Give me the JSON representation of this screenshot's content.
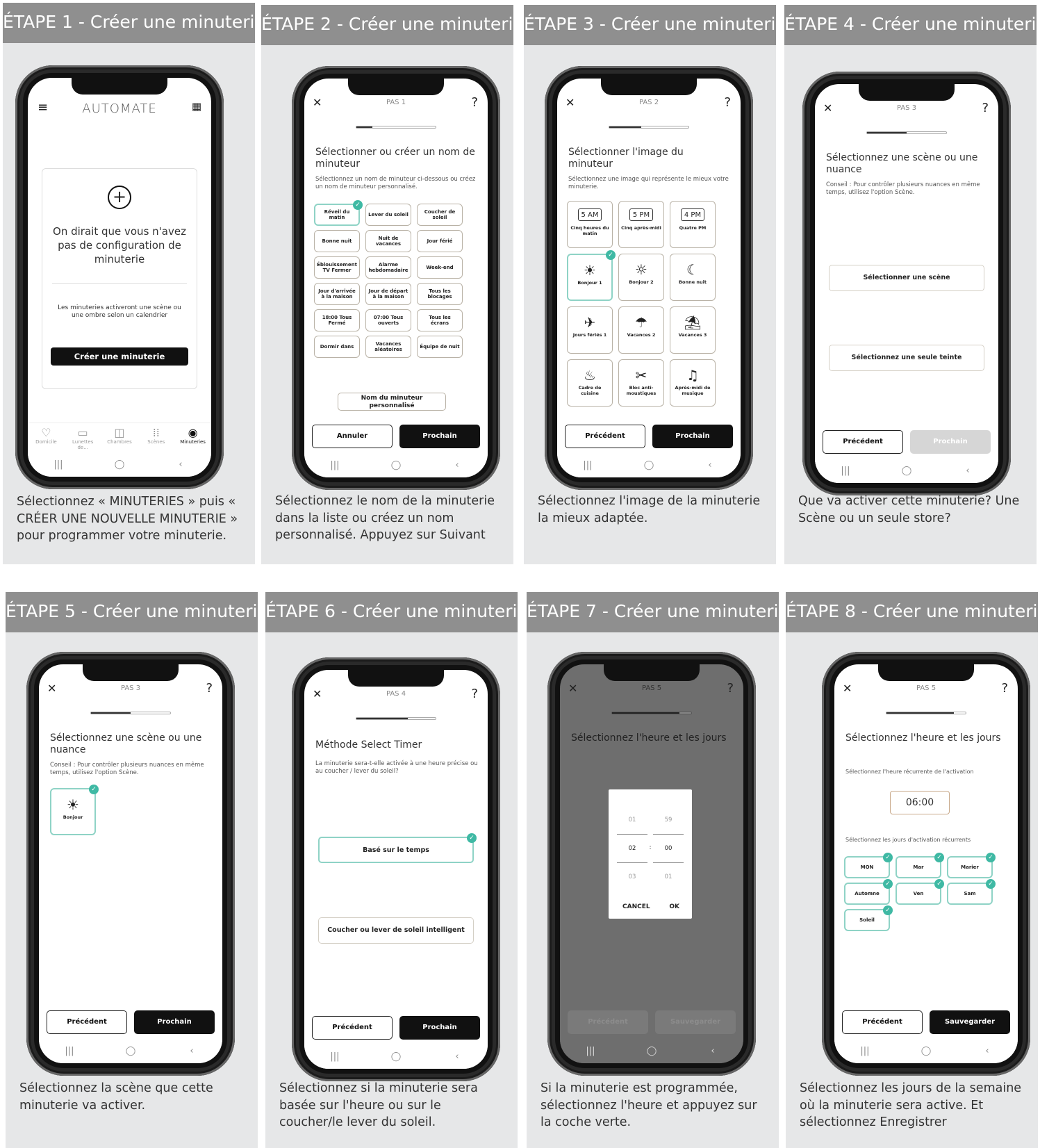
{
  "steps": [
    {
      "header": "ÉTAPE 1 - Créer une minuterie",
      "caption": "Sélectionnez « MINUTERIES » puis « CRÉER UNE NOUVELLE MINUTERIE » pour programmer votre minuterie."
    },
    {
      "header": "ÉTAPE 2 - Créer une minuterie",
      "caption": "Sélectionnez le nom de la minuterie dans la liste ou créez un nom personnalisé. Appuyez sur Suivant"
    },
    {
      "header": "ÉTAPE 3 - Créer une minuterie",
      "caption": "Sélectionnez l'image de la minuterie la mieux adaptée."
    },
    {
      "header": "ÉTAPE 4 - Créer une minuterie",
      "caption": "Que va activer cette minuterie? Une Scène ou un seule store?"
    },
    {
      "header": "ÉTAPE 5 - Créer une minuterie",
      "caption": "Sélectionnez la scène que cette minuterie va activer."
    },
    {
      "header": "ÉTAPE 6 - Créer une minuterie",
      "caption": "Sélectionnez si la minuterie sera basée sur l'heure ou sur le coucher/le lever du soleil."
    },
    {
      "header": "ÉTAPE 7 - Créer une minuterie",
      "caption": "Si la minuterie est programmée, sélectionnez l'heure et appuyez sur la coche verte."
    },
    {
      "header": "ÉTAPE 8 - Créer une minuterie",
      "caption": "Sélectionnez les jours de la semaine où la minuterie sera active. Et sélectionnez Enregistrer"
    }
  ],
  "nav": {
    "recent": "|||",
    "home": "◯",
    "back": "‹",
    "close": "✕",
    "help": "?"
  },
  "s1": {
    "logo": "AUTOMATE",
    "empty": "On dirait que vous n'avez pas de configuration de minuterie",
    "info": "Les minuteries activeront une scène ou une ombre selon un calendrier",
    "create": "Créer une minuterie",
    "tabs": [
      "Domicile",
      "Lunettes de...",
      "Chambres",
      "Scènes",
      "Minuteries"
    ]
  },
  "s2": {
    "pas": "PAS 1",
    "progress": 0.2,
    "title": "Sélectionner ou créer un nom de minuteur",
    "sub": "Sélectionnez un nom de minuteur ci-dessous ou créez un nom de minuteur personnalisé.",
    "chips": [
      "Réveil du matin",
      "Lever du soleil",
      "Coucher de soleil",
      "Bonne nuit",
      "Nuit de vacances",
      "Jour férié",
      "Éblouissement TV Fermer",
      "Alarme hebdomadaire",
      "Week-end",
      "Jour d'arrivée à la maison",
      "Jour de départ à la maison",
      "Tous les blocages",
      "18:00 Tous Fermé",
      "07:00 Tous ouverts",
      "Tous les écrans",
      "Dormir dans",
      "Vacances aléatoires",
      "Équipe de nuit"
    ],
    "custom": "Nom du minuteur personnalisé",
    "cancel": "Annuler",
    "next": "Prochain"
  },
  "s3": {
    "pas": "PAS 2",
    "progress": 0.4,
    "title": "Sélectionner l'image du minuteur",
    "sub": "Sélectionnez une image qui représente le mieux votre minuterie.",
    "tiles": [
      {
        "label": "Cinq heures du matin",
        "icon": "5 AM"
      },
      {
        "label": "Cinq après-midi",
        "icon": "5 PM"
      },
      {
        "label": "Quatre PM",
        "icon": "4 PM"
      },
      {
        "label": "Bonjour 1",
        "icon": "☀"
      },
      {
        "label": "Bonjour 2",
        "icon": "☼"
      },
      {
        "label": "Bonne nuit",
        "icon": "☾"
      },
      {
        "label": "Jours fériés 1",
        "icon": "✈"
      },
      {
        "label": "Vacances 2",
        "icon": "☂"
      },
      {
        "label": "Vacances 3",
        "icon": "⛱"
      },
      {
        "label": "Cadre de cuisine",
        "icon": "♨"
      },
      {
        "label": "Bloc anti-moustiques",
        "icon": "✂"
      },
      {
        "label": "Après-midi de musique",
        "icon": "♫"
      }
    ],
    "prev": "Précédent",
    "next": "Prochain"
  },
  "s4": {
    "pas": "PAS 3",
    "progress": 0.5,
    "title": "Sélectionnez une scène ou une nuance",
    "sub": "Conseil : Pour contrôler plusieurs nuances en même temps, utilisez l'option Scène.",
    "opt1": "Sélectionner une scène",
    "opt2": "Sélectionnez une seule teinte",
    "prev": "Précédent",
    "next": "Prochain"
  },
  "s5": {
    "pas": "PAS 3",
    "progress": 0.5,
    "title": "Sélectionnez une scène ou une nuance",
    "sub": "Conseil : Pour contrôler plusieurs nuances en même temps, utilisez l'option Scène.",
    "scene": "Bonjour",
    "prev": "Précédent",
    "next": "Prochain"
  },
  "s6": {
    "pas": "PAS 4",
    "progress": 0.65,
    "title": "Méthode Select Timer",
    "sub": "La minuterie sera-t-elle activée à une heure précise ou au coucher / lever du soleil?",
    "opt1": "Basé sur le temps",
    "opt2": "Coucher ou lever de soleil intelligent",
    "prev": "Précédent",
    "next": "Prochain"
  },
  "s7": {
    "pas": "PAS 5",
    "progress": 0.85,
    "title": "Sélectionnez l'heure et les jours",
    "hours": [
      "01",
      "02",
      "03"
    ],
    "mins": [
      "59",
      "00",
      "01"
    ],
    "sep": ":",
    "cancel": "CANCEL",
    "ok": "OK",
    "prev": "Précédent",
    "save": "Sauvegarder"
  },
  "s8": {
    "pas": "PAS 5",
    "progress": 0.85,
    "title": "Sélectionnez l'heure et les jours",
    "timeLabel": "Sélectionnez l'heure récurrente de l'activation",
    "time": "06:00",
    "daysLabel": "Sélectionnez les jours d'activation récurrents",
    "days": [
      "MON",
      "Mar",
      "Marier",
      "Automne",
      "Ven",
      "Sam",
      "Soleil"
    ],
    "prev": "Précédent",
    "save": "Sauvegarder"
  },
  "colors": {
    "header": "#8f8f8f",
    "card": "#e6e7e8",
    "check": "#3fb9a4"
  }
}
